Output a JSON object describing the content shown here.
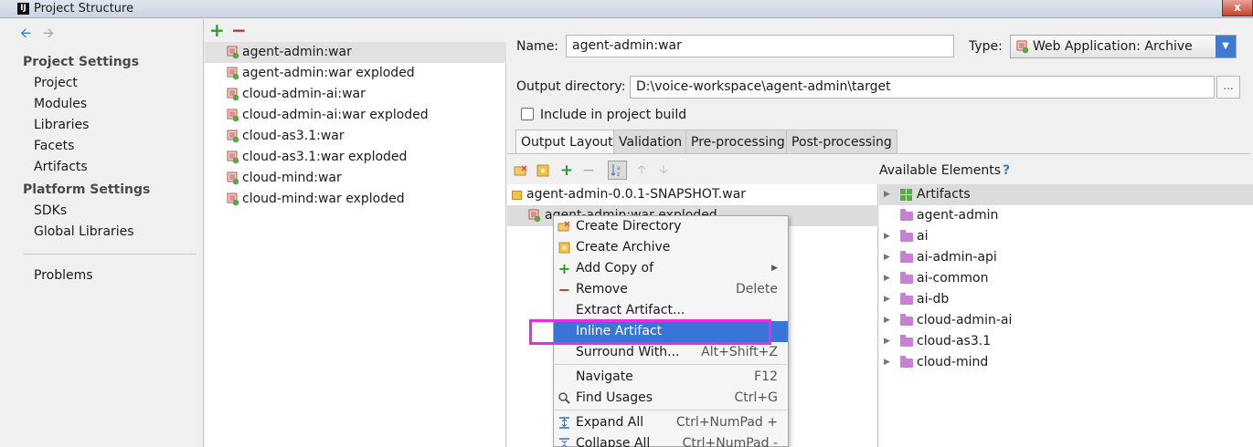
{
  "window": {
    "title": "Project Structure",
    "app_icon": "IJ",
    "close_glyph": "x"
  },
  "nav": {
    "back_icon": "arrow-left-icon",
    "forward_icon": "arrow-right-icon",
    "project_settings_header": "Project Settings",
    "project_items": [
      "Project",
      "Modules",
      "Libraries",
      "Facets",
      "Artifacts"
    ],
    "platform_settings_header": "Platform Settings",
    "platform_items": [
      "SDKs",
      "Global Libraries"
    ],
    "problems": "Problems"
  },
  "artifact_list": {
    "add_glyph": "+",
    "remove_glyph": "−",
    "items": [
      "agent-admin:war",
      "agent-admin:war exploded",
      "cloud-admin-ai:war",
      "cloud-admin-ai:war exploded",
      "cloud-as3.1:war",
      "cloud-as3.1:war exploded",
      "cloud-mind:war",
      "cloud-mind:war exploded"
    ],
    "selected_index": 0
  },
  "editor": {
    "name_label": "Name:",
    "name_value": "agent-admin:war",
    "type_label": "Type:",
    "type_value": "Web Application: Archive",
    "output_dir_label": "Output directory:",
    "output_dir_value": "D:\\voice-workspace\\agent-admin\\target",
    "browse_label": "...",
    "include_label": "Include in project build",
    "include_checked": false,
    "tabs": [
      "Output Layout",
      "Validation",
      "Pre-processing",
      "Post-processing"
    ],
    "active_tab": "Output Layout"
  },
  "layout_tree": {
    "root": "agent-admin-0.0.1-SNAPSHOT.war",
    "child": "agent-admin:war exploded"
  },
  "available": {
    "header": "Available Elements",
    "help_glyph": "?",
    "items": [
      {
        "label": "Artifacts",
        "expandable": true,
        "icon": "artifacts-icon"
      },
      {
        "label": "agent-admin",
        "expandable": false,
        "icon": "folder-icon"
      },
      {
        "label": "ai",
        "expandable": true,
        "icon": "folder-icon"
      },
      {
        "label": "ai-admin-api",
        "expandable": true,
        "icon": "folder-icon"
      },
      {
        "label": "ai-common",
        "expandable": true,
        "icon": "folder-icon"
      },
      {
        "label": "ai-db",
        "expandable": true,
        "icon": "folder-icon"
      },
      {
        "label": "cloud-admin-ai",
        "expandable": true,
        "icon": "folder-icon"
      },
      {
        "label": "cloud-as3.1",
        "expandable": true,
        "icon": "folder-icon"
      },
      {
        "label": "cloud-mind",
        "expandable": true,
        "icon": "folder-icon"
      }
    ]
  },
  "context_menu": {
    "create_directory": "Create Directory",
    "create_archive": "Create Archive",
    "add_copy_of": "Add Copy of",
    "remove": "Remove",
    "remove_shortcut": "Delete",
    "extract_artifact": "Extract Artifact...",
    "inline_artifact": "Inline Artifact",
    "surround_with": "Surround With...",
    "surround_shortcut": "Alt+Shift+Z",
    "navigate": "Navigate",
    "navigate_shortcut": "F12",
    "find_usages": "Find Usages",
    "find_usages_shortcut": "Ctrl+G",
    "expand_all": "Expand All",
    "expand_all_shortcut": "Ctrl+NumPad +",
    "collapse_all": "Collapse All",
    "collapse_all_shortcut": "Ctrl+NumPad -"
  },
  "colors": {
    "selection": "#3875d7",
    "annotation": "#e62ee0",
    "folder": "#c97fd6"
  }
}
